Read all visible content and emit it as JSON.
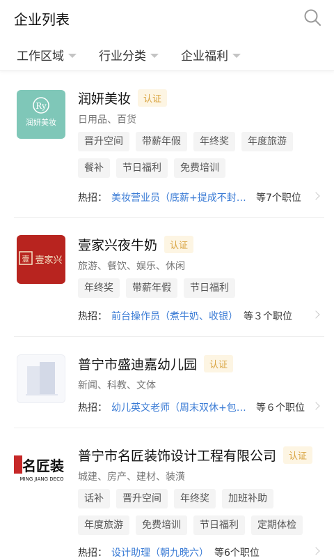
{
  "header": {
    "title": "企业列表"
  },
  "filters": [
    "工作区域",
    "行业分类",
    "企业福利"
  ],
  "companies": [
    {
      "name": "润妍美妆",
      "cert": "认证",
      "industry": "日用品、百货",
      "tags": [
        "晋升空间",
        "带薪年假",
        "年终奖",
        "年度旅游",
        "餐补",
        "节日福利",
        "免费培训"
      ],
      "hot_label": "热招：",
      "hot_job": "美妆营业员（底薪+提成不封顶）",
      "hot_count": "等7个职位",
      "logo_text": "润妍美妆"
    },
    {
      "name": "壹家兴夜牛奶",
      "cert": "认证",
      "industry": "旅游、餐饮、娱乐、休闲",
      "tags": [
        "年终奖",
        "带薪年假",
        "节日福利"
      ],
      "hot_label": "热招：",
      "hot_job": "前台操作员（煮牛奶、收银）",
      "hot_count": "等３个职位",
      "logo_text": "壹家兴"
    },
    {
      "name": "普宁市盛迪嘉幼儿园",
      "cert": "认证",
      "industry": "新闻、科教、文体",
      "tags": [],
      "hot_label": "热招：",
      "hot_job": "幼儿英文老师（周末双休+包吃住）",
      "hot_count": "等６个职位"
    },
    {
      "name": "普宁市名匠装饰设计工程有限公司",
      "cert": "认证",
      "industry": "城建、房产、建材、装潢",
      "tags": [
        "话补",
        "晋升空间",
        "年终奖",
        "加班补助",
        "年度旅游",
        "免费培训",
        "节日福利",
        "定期体检"
      ],
      "hot_label": "热招：",
      "hot_job": "设计助理（朝九晚六）",
      "hot_count": "等6个职位",
      "logo_text": "名匠装",
      "logo_sub": "MING JIANG DECO"
    }
  ]
}
